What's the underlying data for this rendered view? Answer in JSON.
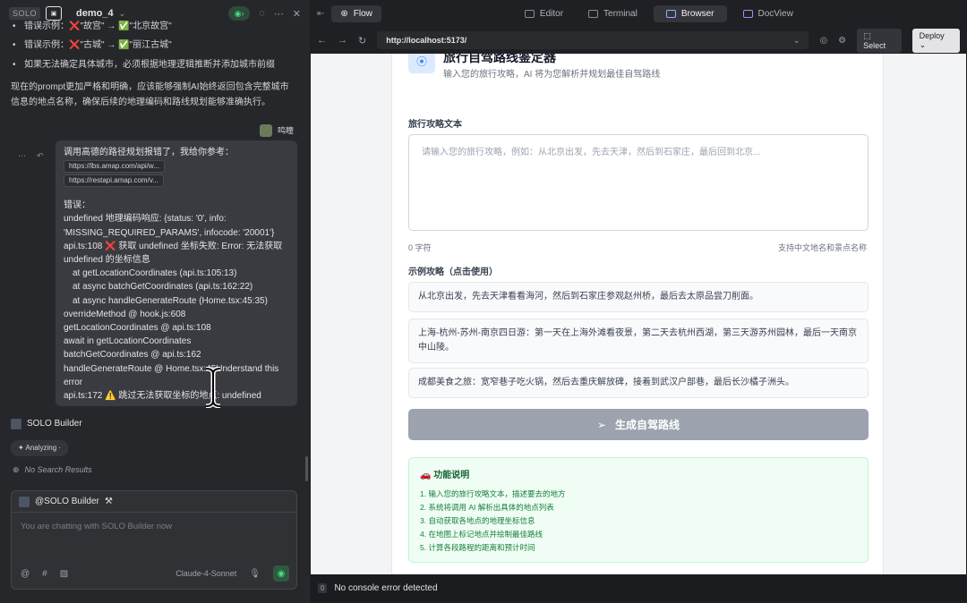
{
  "app": {
    "badge": "SOLO",
    "project": "demo_4"
  },
  "chat": {
    "bullets": [
      "错误示例：❌\"故宫\" → ✅\"北京故宫\"",
      "错误示例：❌\"古城\" → ✅\"丽江古城\"",
      "如果无法确定具体城市，必须根据地理逻辑推断并添加城市前缀"
    ],
    "summary": "现在的prompt更加严格和明确，应该能够强制AI始终返回包含完整城市信息的地点名称，确保后续的地理编码和路线规划能够准确执行。",
    "user_name": "鸣瞳",
    "message": {
      "intro": "调用高德的路径规划报错了，我给你参考：",
      "links": [
        "https://lbs.amap.com/api/w...",
        "https://restapi.amap.com/v..."
      ],
      "error_label": "错误：",
      "lines": [
        "undefined 地理编码响应: {status: '0', info:",
        "'MISSING_REQUIRED_PARAMS', infocode: '20001'}",
        "api.ts:108 ❌ 获取 undefined 坐标失败: Error: 无法获取",
        "undefined 的坐标信息",
        "    at getLocationCoordinates (api.ts:105:13)",
        "    at async batchGetCoordinates (api.ts:162:22)",
        "    at async handleGenerateRoute (Home.tsx:45:35)",
        "overrideMethod @ hook.js:608",
        "getLocationCoordinates @ api.ts:108",
        "await in getLocationCoordinates",
        "batchGetCoordinates @ api.ts:162",
        "handleGenerateRoute @ Home.tsx:45Understand this",
        "error",
        "api.ts:172 ⚠️ 跳过无法获取坐标的地点: undefined"
      ]
    },
    "builder_name": "SOLO Builder",
    "status": "Analyzing",
    "no_results": "No Search Results",
    "input": {
      "mention": "@SOLO Builder",
      "placeholder": "You are chatting with SOLO Builder now",
      "model": "Claude-4-Sonnet"
    }
  },
  "tabs": [
    {
      "label": "Flow"
    },
    {
      "label": "Editor"
    },
    {
      "label": "Terminal"
    },
    {
      "label": "Browser"
    },
    {
      "label": "DocView"
    }
  ],
  "browser": {
    "url": "http://localhost:5173/",
    "select_label": "Select",
    "deploy_label": "Deploy"
  },
  "app_page": {
    "title": "旅行自驾路线鉴定器",
    "subtitle": "输入您的旅行攻略，AI 将为您解析并规划最佳自驾路线",
    "text_label": "旅行攻略文本",
    "placeholder": "请输入您的旅行攻略，例如：从北京出发，先去天津，然后到石家庄，最后回到北京...",
    "count": "0 字符",
    "hint": "支持中文地名和景点名称",
    "examples_label": "示例攻略（点击使用）",
    "examples": [
      "从北京出发，先去天津看看海河，然后到石家庄参观赵州桥，最后去太原品尝刀削面。",
      "上海-杭州-苏州-南京四日游：第一天在上海外滩看夜景，第二天去杭州西湖，第三天游苏州园林，最后一天南京中山陵。",
      "成都美食之旅：宽窄巷子吃火锅，然后去重庆解放碑，接着到武汉户部巷，最后长沙橘子洲头。"
    ],
    "generate_label": "生成自驾路线",
    "features_title": "🚗 功能说明",
    "features": [
      "1. 输入您的旅行攻略文本，描述要去的地方",
      "2. 系统将调用 AI 解析出具体的地点列表",
      "3. 自动获取各地点的地理坐标信息",
      "4. 在地图上标记地点并绘制最佳路线",
      "5. 计算各段路程的距离和预计时间"
    ]
  },
  "console": {
    "count": "0",
    "message": "No console error detected"
  }
}
